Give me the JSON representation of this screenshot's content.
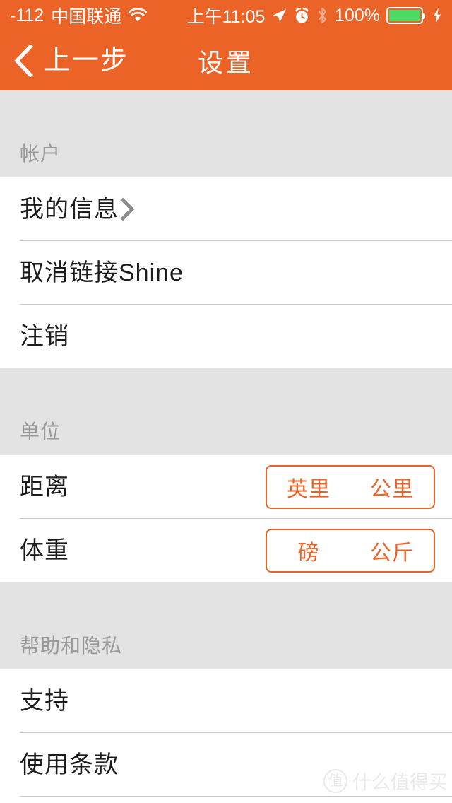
{
  "colors": {
    "brand_orange": "#EC6328",
    "section_gray": "#E3E3E3",
    "separator": "#C9C9C9",
    "row_text": "#1C1C1C",
    "section_text": "#9A9A9A",
    "battery_green": "#4CD964"
  },
  "status_bar": {
    "signal_value": "-112",
    "carrier": "中国联通",
    "wifi_icon": "wifi-icon",
    "time": "上午11:05",
    "location_icon": "location-arrow-icon",
    "alarm_icon": "alarm-clock-icon",
    "bluetooth_icon": "bluetooth-icon",
    "battery_percent": "100%",
    "battery_icon": "battery-full-icon",
    "charging_icon": "lightning-bolt-icon"
  },
  "nav_bar": {
    "back_icon": "chevron-left-icon",
    "back_label": "上一步",
    "title": "设置"
  },
  "sections": [
    {
      "header": "帐户",
      "rows": [
        {
          "label": "我的信息",
          "accessory": "chevron-right-icon"
        },
        {
          "label": "取消链接Shine",
          "accessory": "none"
        },
        {
          "label": "注销",
          "accessory": "none"
        }
      ]
    },
    {
      "header": "单位",
      "rows": [
        {
          "label": "距离",
          "accessory": "segmented-control",
          "options": [
            "英里",
            "公里"
          ],
          "selected_index": -1
        },
        {
          "label": "体重",
          "accessory": "segmented-control",
          "options": [
            "磅",
            "公斤"
          ],
          "selected_index": -1
        }
      ]
    },
    {
      "header": "帮助和隐私",
      "rows": [
        {
          "label": "支持",
          "accessory": "none"
        },
        {
          "label": "使用条款",
          "accessory": "none"
        }
      ]
    }
  ],
  "watermark": {
    "logo_char": "值",
    "text": "什么值得买"
  }
}
